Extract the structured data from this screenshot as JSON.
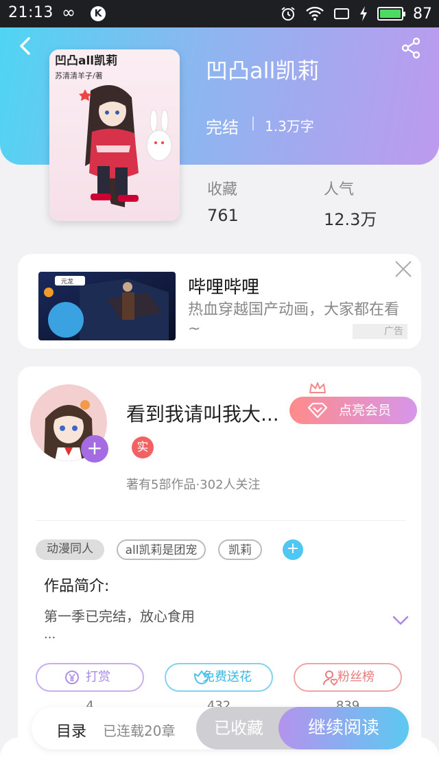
{
  "status_bar": {
    "time": "21:13",
    "loop_icon": "∞",
    "k_icon": "K",
    "battery": "87",
    "battery_color": "#4cd964"
  },
  "book": {
    "title": "凹凸all凯莉",
    "status": "完结",
    "words": "1.3万字",
    "cover_title": "凹凸all凯莉",
    "cover_subtitle": "苏清清羊子/著"
  },
  "stats": [
    {
      "label": "收藏",
      "value": "761"
    },
    {
      "label": "人气",
      "value": "12.3万"
    }
  ],
  "ad": {
    "title": "哔哩哔哩",
    "description": "热血穿越国产动画，大家都在看~",
    "tag": "广告",
    "thumb_label": "元龙"
  },
  "author": {
    "name": "看到我请叫我大...",
    "vip_label": "点亮会员",
    "real_badge": "实",
    "meta": "著有5部作品·302人关注",
    "plus": "+"
  },
  "tags": [
    "动漫同人",
    "all凯莉是团宠",
    "凯莉"
  ],
  "tag_add": "+",
  "intro": {
    "title": "作品简介:",
    "text": "第一季已完结，放心食用",
    "more": "..."
  },
  "actions": [
    {
      "label": "打赏",
      "count": "4",
      "color": "#b08fe6"
    },
    {
      "label": "免费送花",
      "count": "432",
      "color": "#4cc4ea"
    },
    {
      "label": "粉丝榜",
      "count": "839",
      "color": "#e87c7c"
    }
  ],
  "bottom": {
    "toc": "目录",
    "toc_count": "已连载20章",
    "favorited": "已收藏",
    "continue": "继续阅读"
  }
}
